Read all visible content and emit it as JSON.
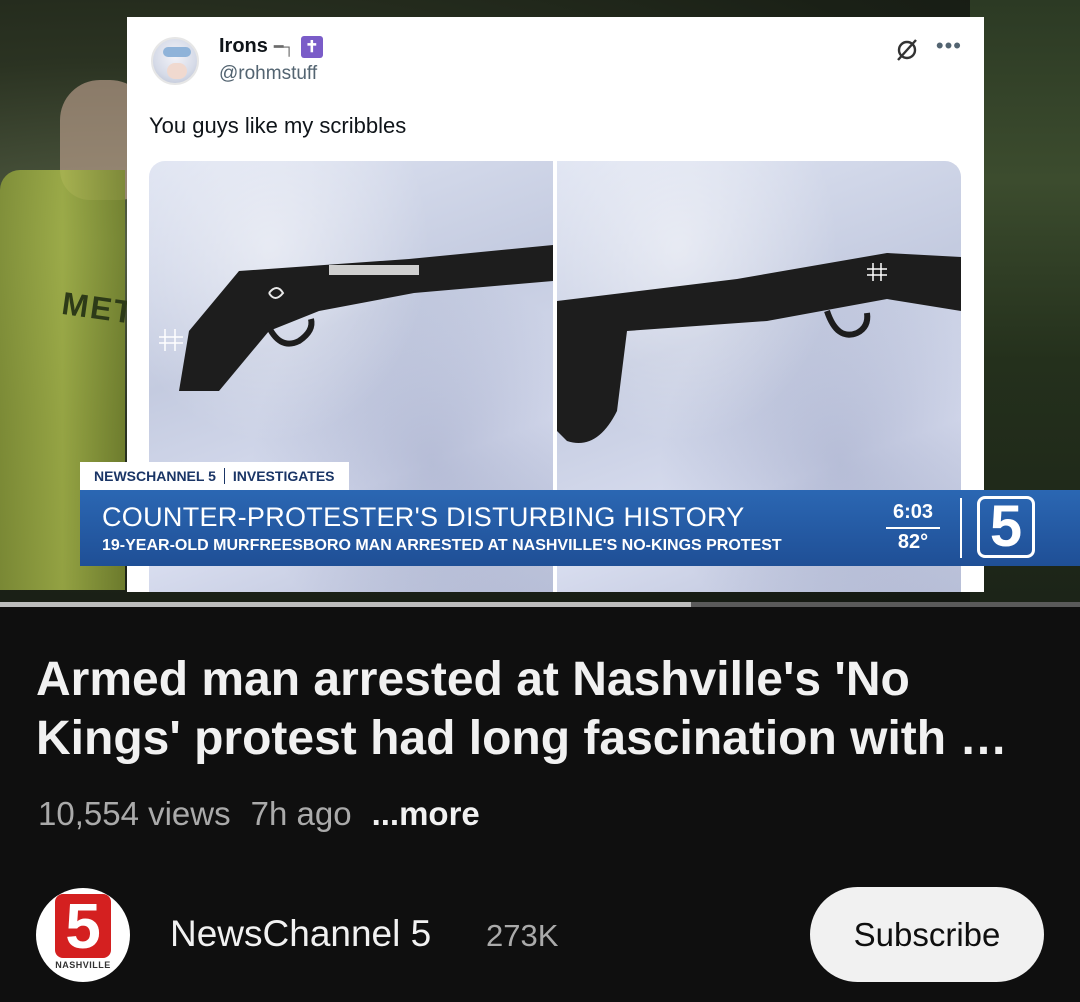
{
  "video": {
    "background_text": "METRO",
    "tweet": {
      "display_name": "Irons",
      "handle": "@rohmstuff",
      "text": "You guys like my scribbles"
    },
    "lower_third": {
      "tab_brand": "NEWSCHANNEL 5",
      "tab_section": "INVESTIGATES",
      "headline": "COUNTER-PROTESTER'S DISTURBING HISTORY",
      "subheadline": "19-YEAR-OLD MURFREESBORO MAN ARRESTED AT NASHVILLE'S NO-KINGS PROTEST",
      "time": "6:03",
      "temperature": "82°",
      "logo": "5"
    },
    "progress": 0.64
  },
  "info": {
    "title": "Armed man arrested at Nashville's 'No Kings' protest had long fascination with …",
    "views": "10,554 views",
    "age": "7h ago",
    "more_label": "...more"
  },
  "channel": {
    "avatar_number": "5",
    "avatar_city": "NASHVILLE",
    "name": "NewsChannel 5",
    "subscribers": "273K",
    "subscribe_label": "Subscribe"
  },
  "colors": {
    "lower_third_blue": "#2b67b3",
    "lower_third_text": "#1a3566",
    "avatar_red": "#d42020",
    "background": "#0f0f0f"
  }
}
